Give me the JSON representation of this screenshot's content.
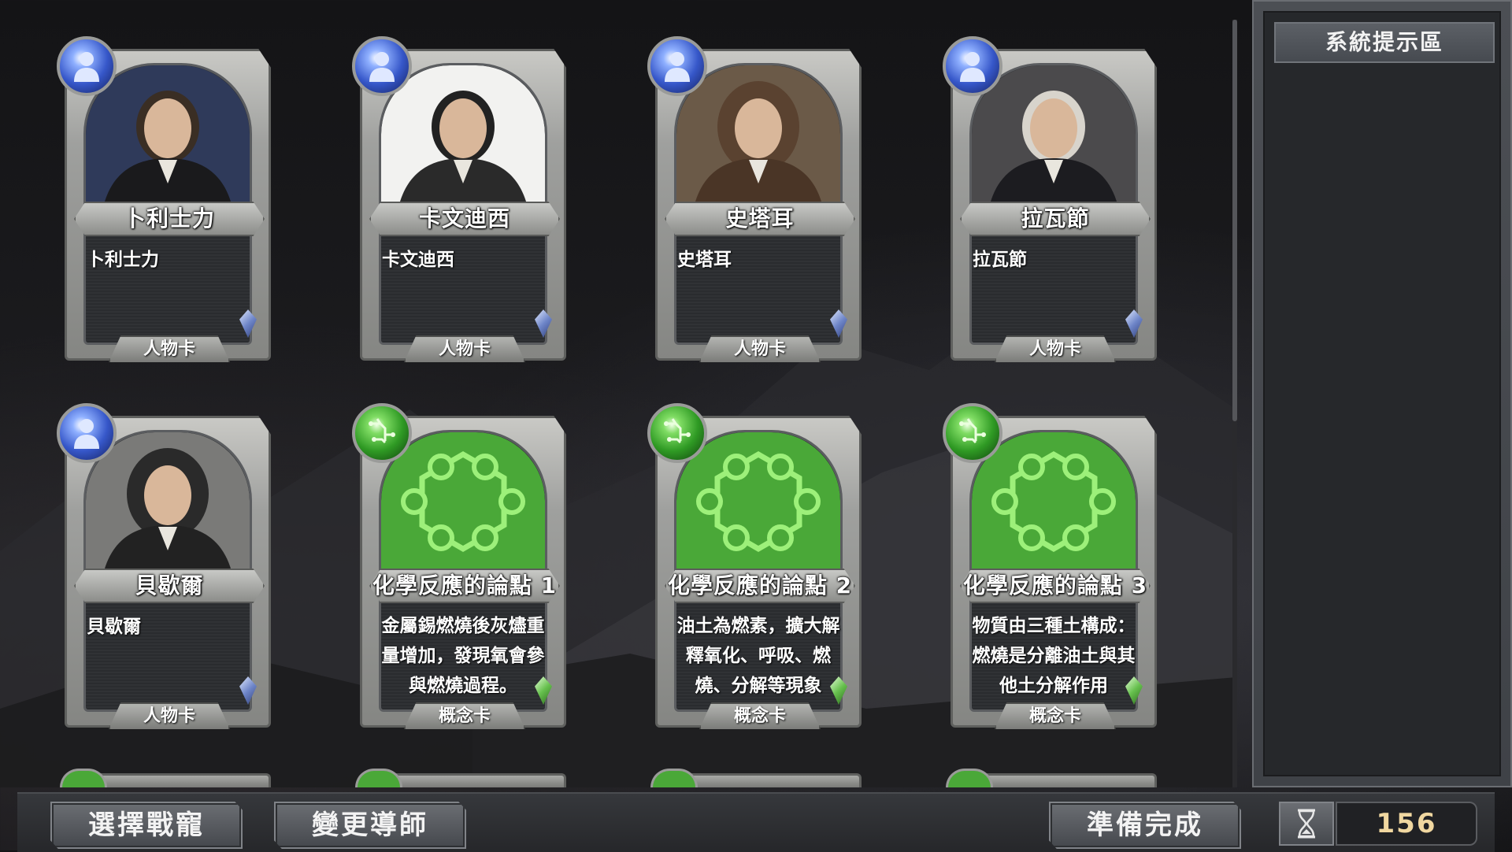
{
  "side_panel": {
    "title": "系統提示區"
  },
  "cards": [
    {
      "name": "卜利士力",
      "desc": "卜利士力",
      "type": "人物卡",
      "kind": "person",
      "icon": "person-icon"
    },
    {
      "name": "卡文迪西",
      "desc": "卡文迪西",
      "type": "人物卡",
      "kind": "person",
      "icon": "person-icon"
    },
    {
      "name": "史塔耳",
      "desc": "史塔耳",
      "type": "人物卡",
      "kind": "person",
      "icon": "person-icon"
    },
    {
      "name": "拉瓦節",
      "desc": "拉瓦節",
      "type": "人物卡",
      "kind": "person",
      "icon": "person-icon"
    },
    {
      "name": "貝歇爾",
      "desc": "貝歇爾",
      "type": "人物卡",
      "kind": "person",
      "icon": "person-icon"
    },
    {
      "name": "化學反應的論點 1",
      "desc": "金屬錫燃燒後灰燼重量增加，發現氧會參與燃燒過程。",
      "type": "概念卡",
      "kind": "concept",
      "icon": "circuit-icon"
    },
    {
      "name": "化學反應的論點 2",
      "desc": "油土為燃素，擴大解釋氧化、呼吸、燃燒、分解等現象",
      "type": "概念卡",
      "kind": "concept",
      "icon": "circuit-icon"
    },
    {
      "name": "化學反應的論點 3",
      "desc": "物質由三種土構成：燃燒是分離油土與其他土分解作用",
      "type": "概念卡",
      "kind": "concept",
      "icon": "circuit-icon"
    }
  ],
  "buttons": {
    "select_pet": "選擇戰寵",
    "change_mentor": "變更導師",
    "ready": "準備完成"
  },
  "timer": {
    "value": "156",
    "icon": "hourglass-icon"
  },
  "colors": {
    "person_orb": "#3657c9",
    "concept_orb": "#2f9a24",
    "concept_art": "#4aa838",
    "timer_text": "#f0d7a0"
  }
}
